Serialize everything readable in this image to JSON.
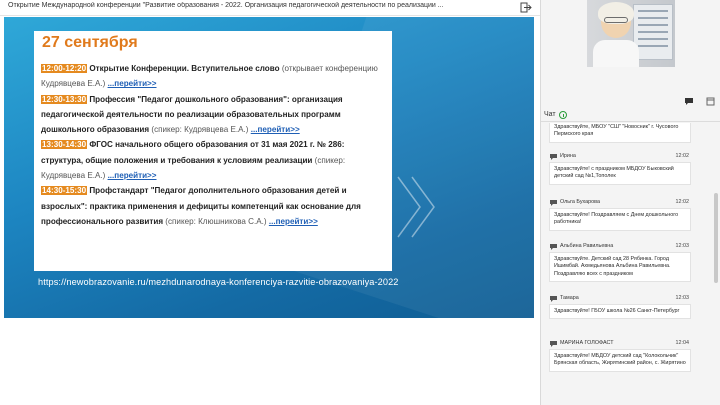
{
  "window": {
    "title": "Открытие Международной конференции \"Развитие образования - 2022. Организация педагогической деятельности по реализации ..."
  },
  "slide": {
    "date": "27 сентября",
    "items": [
      {
        "time": "12:00-12:20",
        "title": "Открытие Конференции. Вступительное слово",
        "speaker": "(открывает конференцию Кудрявцева Е.А.)",
        "link": "...перейти>>"
      },
      {
        "time": "12:30-13:30",
        "title": "Профессия \"Педагог дошкольного образования\": организация педагогической деятельности по реализации образовательных программ дошкольного образования",
        "speaker": "(спикер: Кудрявцева Е.А.)",
        "link": "...перейти>>"
      },
      {
        "time": "13:30-14:30",
        "title": "ФГОС начального общего образования от 31 мая 2021 г. № 286: структура, общие положения и требования к условиям реализации",
        "speaker": "(спикер: Кудрявцева Е.А.)",
        "link": "...перейти>>"
      },
      {
        "time": "14:30-15:30",
        "title": "Профстандарт \"Педагог дополнительного образования детей и взрослых\": практика применения и дефициты компетенций как основание для профессионального развития",
        "speaker": "(спикер: Клюшникова С.А.)",
        "link": "...перейти>>"
      }
    ],
    "url": "https://newobrazovanie.ru/mezhdunarodnaya-konferenciya-razvitie-obrazovaniya-2022"
  },
  "chat": {
    "label": "Чат",
    "messages": [
      {
        "name": "",
        "time": "",
        "text": "Здравствуйте, МБОУ \"СШ\" \"Новосник\" г. Чусового Пермского края"
      },
      {
        "name": "Ирина",
        "time": "12:02",
        "text": "Здравствуйте! с праздником МБДОУ Быковский детский сад №1,Тополек"
      },
      {
        "name": "Ольга Бухарова",
        "time": "12:02",
        "text": "Здравствуйте! Поздравляем с Днем дошкольного работника!"
      },
      {
        "name": "Альбина Равильевна",
        "time": "12:03",
        "text": "Здравствуйте. Детский сад 28 Рябинка. Город Ишимбай. Ахмедьянова Альбина Равильевна. Поздравляю всех с праздником"
      },
      {
        "name": "Тамара",
        "time": "12:03",
        "text": "Здравствуйте! ГБОУ школа №26 Санкт-Петербург"
      },
      {
        "name": "МАРИНА ГОЛОФАСТ",
        "time": "12:04",
        "text": "Здравствуйте! МБДОУ детский сад \"Колокольчик\" Брянская область, Жирятинский район, с. Жирятино"
      }
    ]
  },
  "icons": {
    "exit": "exit-icon",
    "chat": "chat-bubble-icon",
    "window": "window-icon",
    "info": "info-icon",
    "message": "message-icon"
  },
  "colors": {
    "accent_orange": "#e58a1f",
    "date_orange": "#e07a1c",
    "link_blue": "#1f5fb5",
    "slide_blue": "#1d86c2"
  }
}
